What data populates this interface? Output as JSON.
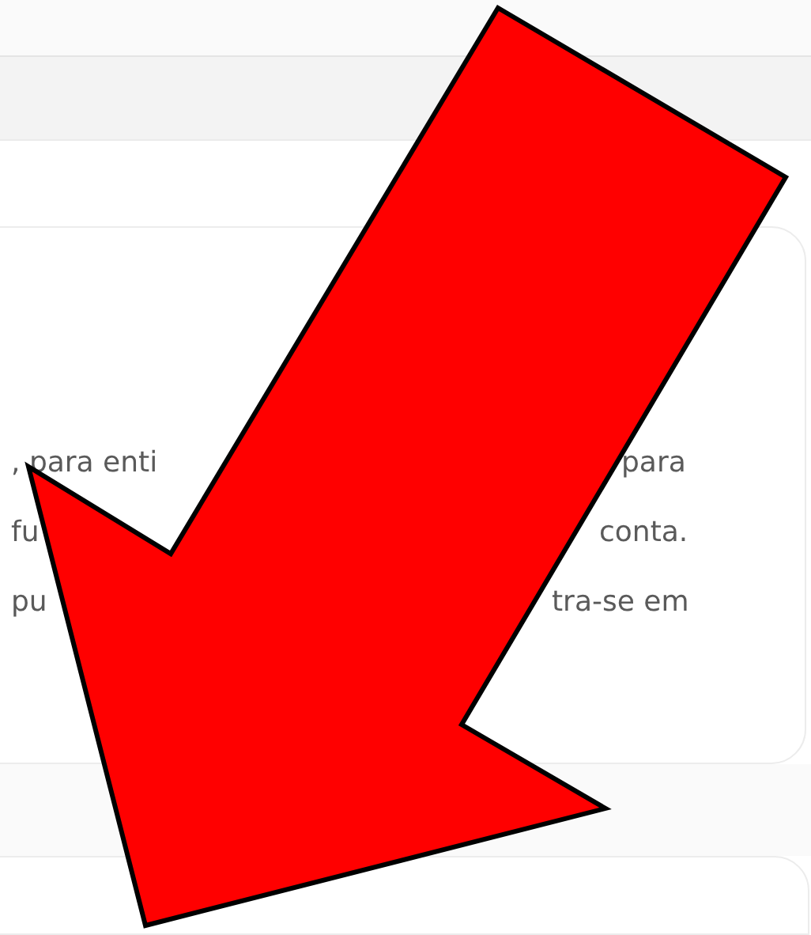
{
  "card": {
    "lines": [
      {
        "fragments": [
          ", para enti",
          "para"
        ]
      },
      {
        "fragments": [
          "fu",
          "conta."
        ]
      },
      {
        "fragments": [
          "pu",
          "tra-se em"
        ]
      }
    ]
  }
}
